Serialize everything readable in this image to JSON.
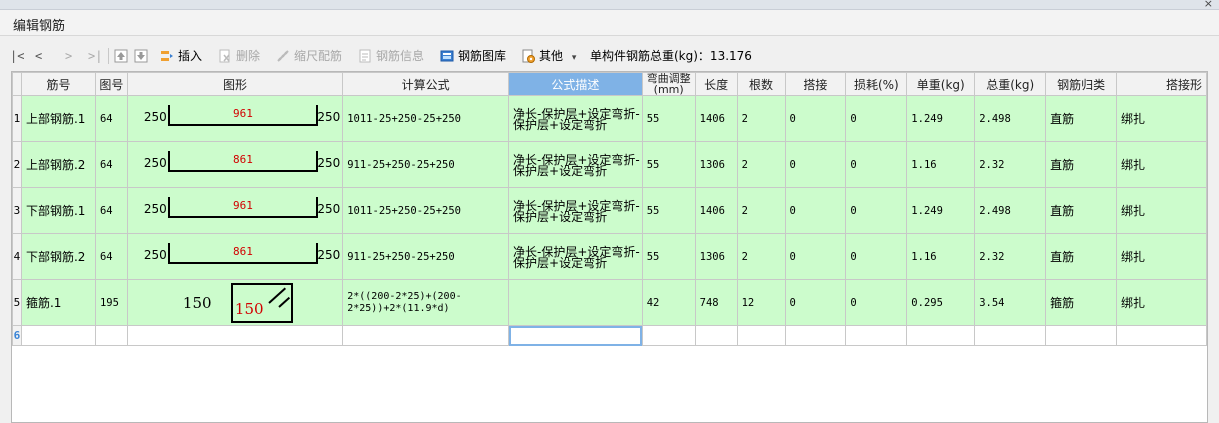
{
  "window": {
    "title": "编辑钢筋",
    "close_glyph": "×"
  },
  "toolbar": {
    "first": "|<",
    "prev": "<",
    "next": ">",
    "last": ">|",
    "insert": "插入",
    "delete": "删除",
    "scale": "缩尺配筋",
    "info": "钢筋信息",
    "library": "钢筋图库",
    "other": "其他",
    "other_arrow": "▾",
    "total_label": "单构件钢筋总重(kg)：13.176"
  },
  "table": {
    "columns": [
      "筋号",
      "图号",
      "图形",
      "计算公式",
      "公式描述",
      "弯曲调整(mm)",
      "长度",
      "根数",
      "搭接",
      "损耗(%)",
      "单重(kg)",
      "总重(kg)",
      "钢筋归类",
      "搭接形"
    ],
    "rows": [
      {
        "num": "1",
        "name": "上部钢筋.1",
        "fig": "64",
        "shape_left": "250",
        "shape_mid": "961",
        "shape_right": "250",
        "formula": "1011-25+250-25+250",
        "desc": "净长-保护层+设定弯折-保护层+设定弯折",
        "bend": "55",
        "length": "1406",
        "count": "2",
        "lap": "0",
        "loss": "0",
        "unit_w": "1.249",
        "total_w": "2.498",
        "category": "直筋",
        "lap_type": "绑扎"
      },
      {
        "num": "2",
        "name": "上部钢筋.2",
        "fig": "64",
        "shape_left": "250",
        "shape_mid": "861",
        "shape_right": "250",
        "formula": "911-25+250-25+250",
        "desc": "净长-保护层+设定弯折-保护层+设定弯折",
        "bend": "55",
        "length": "1306",
        "count": "2",
        "lap": "0",
        "loss": "0",
        "unit_w": "1.16",
        "total_w": "2.32",
        "category": "直筋",
        "lap_type": "绑扎"
      },
      {
        "num": "3",
        "name": "下部钢筋.1",
        "fig": "64",
        "shape_left": "250",
        "shape_mid": "961",
        "shape_right": "250",
        "formula": "1011-25+250-25+250",
        "desc": "净长-保护层+设定弯折-保护层+设定弯折",
        "bend": "55",
        "length": "1406",
        "count": "2",
        "lap": "0",
        "loss": "0",
        "unit_w": "1.249",
        "total_w": "2.498",
        "category": "直筋",
        "lap_type": "绑扎"
      },
      {
        "num": "4",
        "name": "下部钢筋.2",
        "fig": "64",
        "shape_left": "250",
        "shape_mid": "861",
        "shape_right": "250",
        "formula": "911-25+250-25+250",
        "desc": "净长-保护层+设定弯折-保护层+设定弯折",
        "bend": "55",
        "length": "1306",
        "count": "2",
        "lap": "0",
        "loss": "0",
        "unit_w": "1.16",
        "total_w": "2.32",
        "category": "直筋",
        "lap_type": "绑扎"
      }
    ],
    "stirrup": {
      "num": "5",
      "name": "箍筋.1",
      "fig": "195",
      "shape_left": "150",
      "shape_box": "150",
      "formula": "2*((200-2*25)+(200-2*25))+2*(11.9*d)",
      "desc": "",
      "bend": "42",
      "length": "748",
      "count": "12",
      "lap": "0",
      "loss": "0",
      "unit_w": "0.295",
      "total_w": "3.54",
      "category": "箍筋",
      "lap_type": "绑扎"
    },
    "empty_row_num": "6"
  }
}
